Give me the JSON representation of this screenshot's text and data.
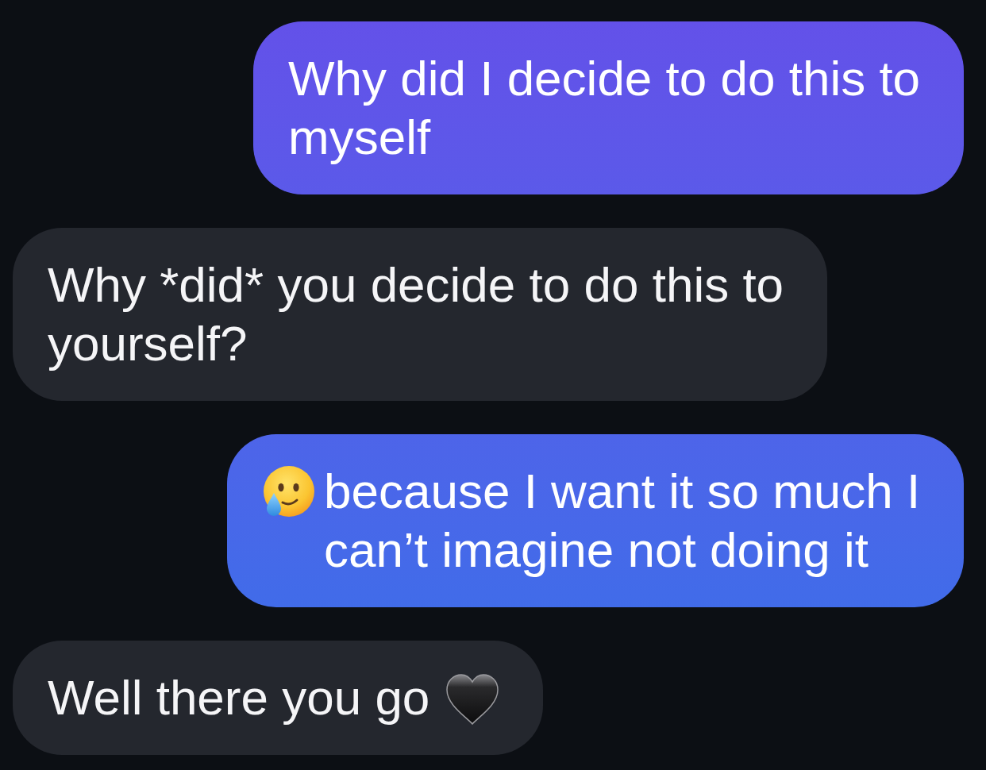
{
  "messages": [
    {
      "kind": "sent",
      "text": "Why did I decide to do this to myself"
    },
    {
      "kind": "received",
      "text": "Why *did* you decide to do this to yourself?"
    },
    {
      "kind": "sent",
      "leading_icon": {
        "kind": "smile-tear"
      },
      "text": "because I want it so much I can’t imagine not doing it"
    },
    {
      "kind": "received",
      "text": "Well there you go",
      "trailing_icon": {
        "kind": "heart"
      }
    }
  ]
}
